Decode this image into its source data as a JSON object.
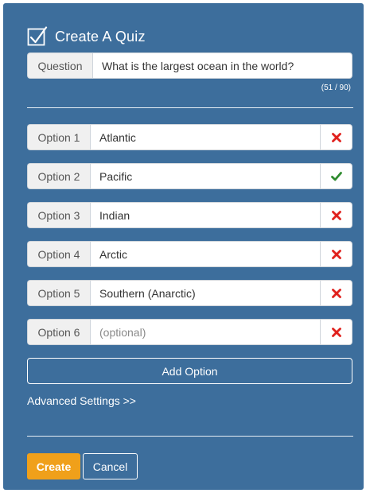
{
  "quiz": {
    "title": "Create A Quiz",
    "icon": "checkbox-check-icon"
  },
  "question": {
    "label": "Question",
    "value": "What is the largest ocean in the world?",
    "counter": "(51 / 90)"
  },
  "options": [
    {
      "label": "Option 1",
      "value": "Atlantic",
      "placeholder": "",
      "status": "incorrect",
      "status_icon": "red-x-icon"
    },
    {
      "label": "Option 2",
      "value": "Pacific",
      "placeholder": "",
      "status": "correct",
      "status_icon": "green-check-icon"
    },
    {
      "label": "Option 3",
      "value": "Indian",
      "placeholder": "",
      "status": "incorrect",
      "status_icon": "red-x-icon"
    },
    {
      "label": "Option 4",
      "value": "Arctic",
      "placeholder": "",
      "status": "incorrect",
      "status_icon": "red-x-icon"
    },
    {
      "label": "Option 5",
      "value": "Southern (Anarctic)",
      "placeholder": "",
      "status": "incorrect",
      "status_icon": "red-x-icon"
    },
    {
      "label": "Option 6",
      "value": "",
      "placeholder": "(optional)",
      "status": "incorrect",
      "status_icon": "red-x-icon"
    }
  ],
  "actions": {
    "add_option": "Add Option",
    "advanced_settings": "Advanced Settings >>",
    "create": "Create",
    "cancel": "Cancel"
  },
  "colors": {
    "panel": "#3d6e9c",
    "primary_button": "#f0a01a",
    "correct": "#2e8b2e",
    "incorrect": "#e0201c"
  }
}
